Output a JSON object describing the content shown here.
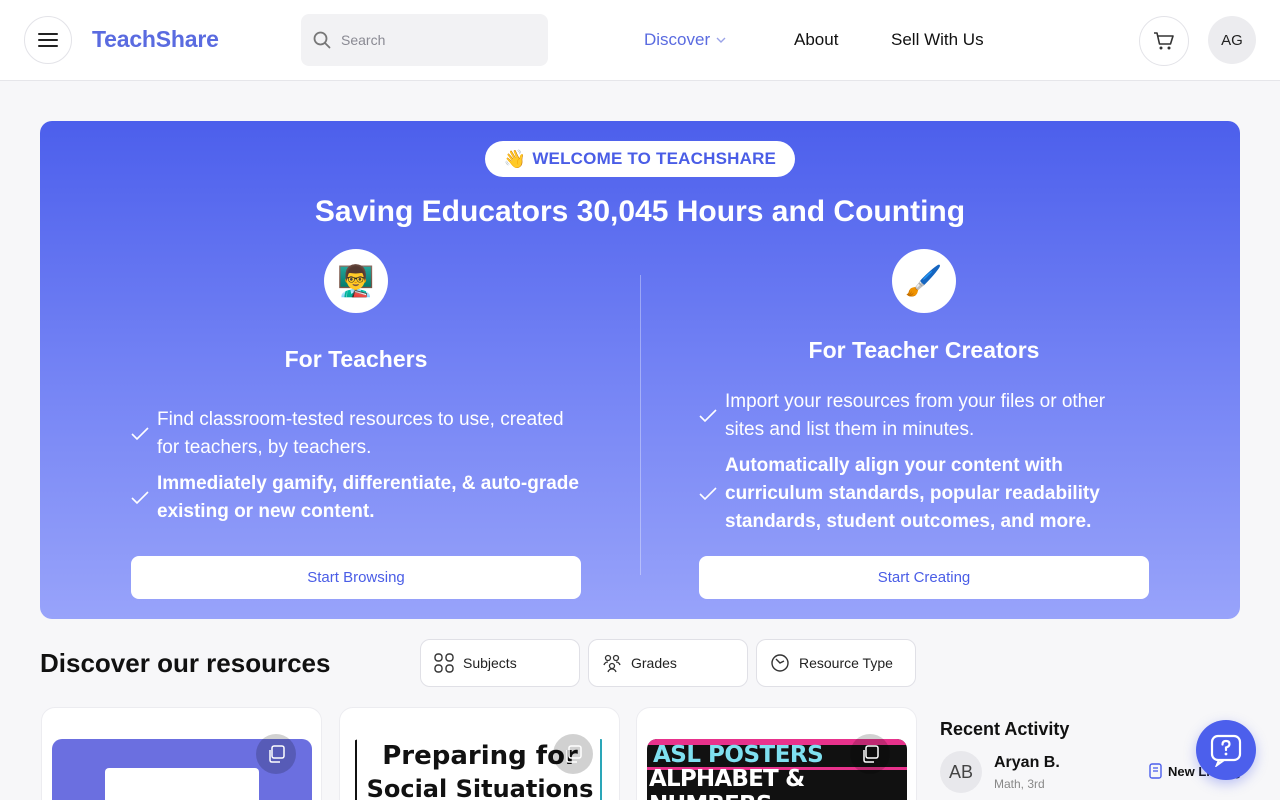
{
  "header": {
    "logo": "TeachShare",
    "search_placeholder": "Search",
    "nav": {
      "discover": "Discover",
      "about": "About",
      "sell": "Sell With Us"
    },
    "avatar_initials": "AG"
  },
  "hero": {
    "welcome_emoji": "👋",
    "welcome_text": "WELCOME TO TEACHSHARE",
    "title": "Saving Educators 30,045 Hours and Counting",
    "teachers": {
      "emoji": "👨‍🏫",
      "title": "For Teachers",
      "bullets": [
        "Find classroom-tested resources to use, created for teachers, by teachers.",
        "Immediately gamify, differentiate, & auto-grade existing or new content."
      ],
      "button": "Start Browsing"
    },
    "creators": {
      "emoji": "🖌️",
      "title": "For Teacher Creators",
      "bullets": [
        "Import your resources from your files or other sites and list them in minutes.",
        "Automatically align your content with curriculum standards, popular readability standards, student outcomes, and more."
      ],
      "button": "Start Creating"
    }
  },
  "discover": {
    "title": "Discover our resources",
    "filters": [
      "Subjects",
      "Grades",
      "Resource Type"
    ],
    "cards": [
      {
        "text_line1": "",
        "text_line2": ""
      },
      {
        "text_line1": "Preparing for",
        "text_line2": "Social Situations"
      },
      {
        "text_line1": "ASL POSTERS",
        "text_line2": "ALPHABET & NUMBERS"
      }
    ]
  },
  "recent": {
    "title": "Recent Activity",
    "item": {
      "initials": "AB",
      "name": "Aryan B.",
      "sub": "Math, 3rd",
      "tag": "New Listing"
    }
  },
  "colors": {
    "accent": "#5a6be0",
    "hero_top": "#4c5fec",
    "hero_bottom": "#98a3fa"
  }
}
